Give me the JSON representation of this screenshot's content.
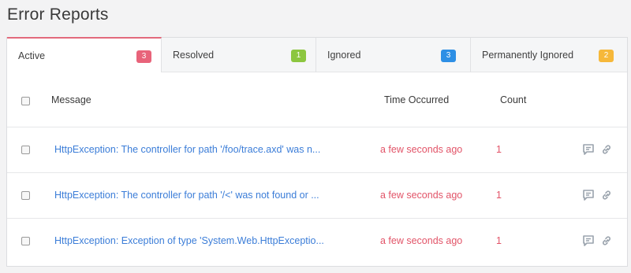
{
  "page": {
    "title": "Error Reports"
  },
  "tabs": [
    {
      "label": "Active",
      "count": "3",
      "color": "#e8637a"
    },
    {
      "label": "Resolved",
      "count": "1",
      "color": "#8cc63f"
    },
    {
      "label": "Ignored",
      "count": "3",
      "color": "#2d8fe5"
    },
    {
      "label": "Permanently Ignored",
      "count": "2",
      "color": "#f6b83a"
    }
  ],
  "table": {
    "headers": {
      "message": "Message",
      "time": "Time Occurred",
      "count": "Count"
    },
    "rows": [
      {
        "message": "HttpException: The controller for path '/foo/trace.axd' was n...",
        "time": "a few seconds ago",
        "count": "1"
      },
      {
        "message": "HttpException: The controller for path '/<' was not found or ...",
        "time": "a few seconds ago",
        "count": "1"
      },
      {
        "message": "HttpException: Exception of type 'System.Web.HttpExceptio...",
        "time": "a few seconds ago",
        "count": "1"
      }
    ]
  },
  "icons": {
    "comment": "comment-icon",
    "link": "link-icon"
  },
  "colors": {
    "active_tab_accent": "#e26a7c",
    "message_link": "#3b7dd8",
    "time_text": "#e25468",
    "icon_gray": "#9aa3ad"
  }
}
